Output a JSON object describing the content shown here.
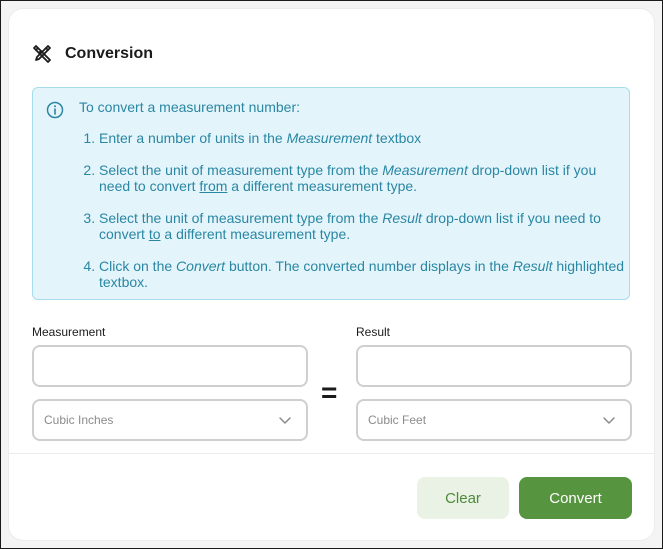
{
  "dialog": {
    "title": "Conversion",
    "title_icon": "tools-icon"
  },
  "info": {
    "icon": "info-icon",
    "intro": "To convert a measurement number:",
    "steps": [
      {
        "before": "Enter a number of units in the ",
        "emph": "Measurement",
        "after": " textbox"
      },
      {
        "before": "Select the unit of measurement type from the ",
        "emph": "Measurement",
        "middle": " drop-down list if you need to convert ",
        "underline": "from",
        "after": " a different measurement type."
      },
      {
        "before": "Select the unit of measurement type from the ",
        "emph": "Result",
        "middle": " drop-down list if you need to convert ",
        "underline": "to",
        "after": " a different measurement type."
      },
      {
        "before": "Click on the ",
        "emph": "Convert",
        "middle": " button. The converted number displays in the ",
        "emph2": "Result",
        "after": " highlighted textbox."
      }
    ]
  },
  "measurement": {
    "label": "Measurement",
    "value": "",
    "unit": "Cubic Inches"
  },
  "equals": "=",
  "result": {
    "label": "Result",
    "value": "",
    "unit": "Cubic Feet"
  },
  "buttons": {
    "clear": "Clear",
    "convert": "Convert"
  },
  "colors": {
    "accent": "#569440",
    "info_background": "#e3f5fb",
    "info_text": "#2a86a3"
  }
}
